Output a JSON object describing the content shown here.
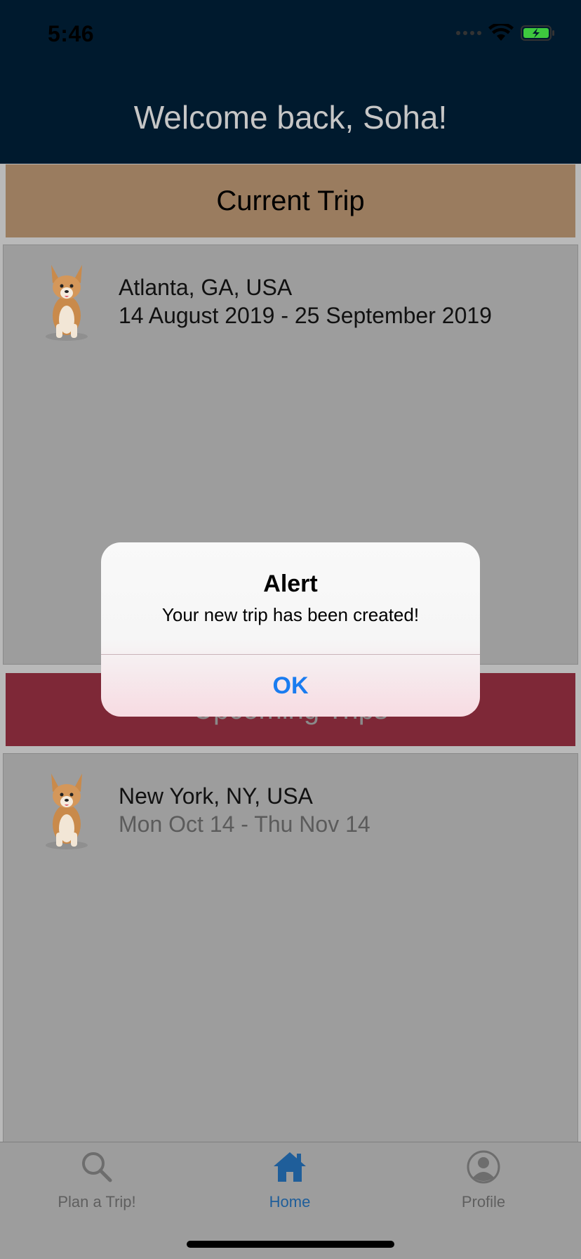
{
  "status_bar": {
    "time": "5:46"
  },
  "header": {
    "welcome": "Welcome back, Soha!"
  },
  "sections": {
    "current_label": "Current Trip",
    "upcoming_label": "Upcoming Trips"
  },
  "current_trip": {
    "location": "Atlanta, GA, USA",
    "dates": "14 August 2019 - 25 September 2019"
  },
  "upcoming_trip": {
    "location": "New York, NY, USA",
    "dates": "Mon Oct 14 - Thu Nov 14"
  },
  "tabbar": {
    "tabs": [
      {
        "label": "Plan a Trip!",
        "icon": "search-icon",
        "active": false
      },
      {
        "label": "Home",
        "icon": "home-icon",
        "active": true
      },
      {
        "label": "Profile",
        "icon": "person-icon",
        "active": false
      }
    ]
  },
  "alert": {
    "title": "Alert",
    "message": "Your new trip has been created!",
    "ok_label": "OK"
  },
  "colors": {
    "header_bg": "#001a2e",
    "current_bar": "#9a7c5f",
    "upcoming_bar": "#7e2837",
    "active_tab": "#1f5e9a",
    "alert_button": "#1a7cf0"
  }
}
